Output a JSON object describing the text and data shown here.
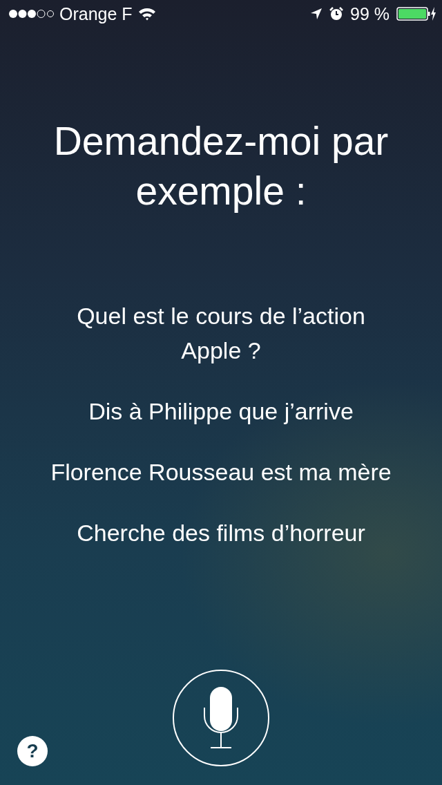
{
  "status_bar": {
    "carrier": "Orange F",
    "battery_percent": "99 %"
  },
  "title": "Demandez-moi par exemple :",
  "suggestions": [
    "Quel est le cours de l’action Apple ?",
    "Dis à Philippe que j’arrive",
    "Florence Rousseau est ma mère",
    "Cherche des films d’horreur"
  ],
  "help_button": {
    "label": "?"
  }
}
